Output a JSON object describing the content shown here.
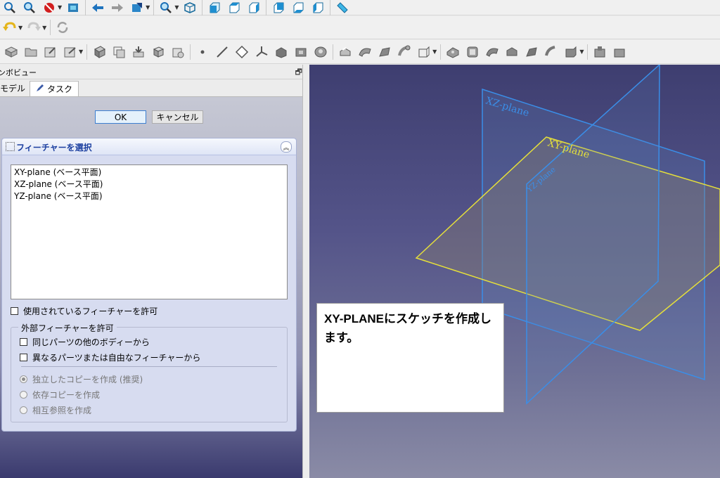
{
  "combo": {
    "title": "ンボビュー",
    "tabs": {
      "model": "モデル",
      "task": "タスク"
    }
  },
  "buttons": {
    "ok": "OK",
    "cancel": "キャンセル"
  },
  "feature_panel": {
    "title": "フィーチャーを選択",
    "items": [
      "XY-plane (ベース平面)",
      "XZ-plane (ベース平面)",
      "YZ-plane (ベース平面)"
    ],
    "allow_used": "使用されているフィーチャーを許可",
    "external": {
      "title": "外部フィーチャーを許可",
      "same_part": "同じパーツの他のボディーから",
      "other_part": "異なるパーツまたは自由なフィーチャーから",
      "radios": [
        {
          "label": "独立したコピーを作成 (推奨)",
          "selected": true
        },
        {
          "label": "依存コピーを作成",
          "selected": false
        },
        {
          "label": "相互参照を作成",
          "selected": false
        }
      ]
    }
  },
  "viewport": {
    "labels": {
      "xz": "XZ-plane",
      "xy": "XY-plane",
      "yz": "YZ-plane"
    },
    "colors": {
      "xz": "#3a8ee8",
      "xy": "#e6e03a",
      "yz": "#3a8ee8"
    }
  },
  "callout": {
    "text": "XY-PLANEにスケッチを作成します。"
  },
  "icons": {
    "toolbar1": [
      "fit-all-icon",
      "zoom-icon",
      "stop-icon",
      "refresh-view-icon",
      "back-arrow-icon",
      "forward-arrow-icon",
      "workbench-icon",
      "zoom-drop-icon",
      "isometric-view-icon",
      "front-view-icon",
      "top-view-icon",
      "right-view-icon",
      "rear-view-icon",
      "bottom-view-icon",
      "left-view-icon",
      "measure-icon"
    ],
    "toolbar2": [
      "undo-icon",
      "redo-icon",
      "reload-icon"
    ],
    "toolbar3": [
      "create-body-icon",
      "create-part-icon",
      "new-sketch-icon",
      "validate-sketch-icon",
      "shape-binder-icon",
      "clone-icon",
      "point-icon",
      "line-icon",
      "plane-icon",
      "lcs-icon",
      "pad-icon",
      "pocket-icon",
      "hole-icon",
      "groove-icon",
      "revolution-icon",
      "loft-icon",
      "pipe-icon",
      "additive-box-icon",
      "subtractive-box-icon",
      "fillet-icon",
      "chamfer-icon",
      "draft-icon",
      "thickness-icon"
    ]
  }
}
